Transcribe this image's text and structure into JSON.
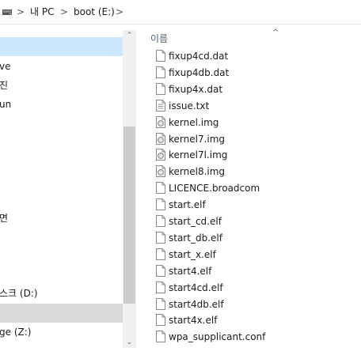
{
  "address": {
    "crumbs": [
      "내 PC",
      "boot (E:)"
    ],
    "separators": [
      ">",
      ">",
      ">"
    ]
  },
  "nav": {
    "items": [
      {
        "label": "",
        "state": "selected"
      },
      {
        "label": "ve",
        "state": ""
      },
      {
        "label": "진",
        "state": ""
      },
      {
        "label": "un",
        "state": ""
      },
      {
        "label": "",
        "state": ""
      },
      {
        "label": "",
        "state": ""
      },
      {
        "label": "",
        "state": ""
      },
      {
        "label": "",
        "state": ""
      },
      {
        "label": "면",
        "state": ""
      },
      {
        "label": "",
        "state": ""
      },
      {
        "label": "",
        "state": ""
      },
      {
        "label": "스크 (D:)",
        "state": ""
      },
      {
        "label": "",
        "state": "focused"
      },
      {
        "label": "ge (Z:)",
        "state": ""
      }
    ],
    "scroll_up_glyph": "⌃",
    "scroll_down_glyph": "⌄"
  },
  "filelist": {
    "column_header": "이름",
    "sort_glyph": "^",
    "files": [
      {
        "name": "fixup4cd.dat",
        "icon": "generic-file-icon"
      },
      {
        "name": "fixup4db.dat",
        "icon": "generic-file-icon"
      },
      {
        "name": "fixup4x.dat",
        "icon": "generic-file-icon"
      },
      {
        "name": "issue.txt",
        "icon": "text-file-icon"
      },
      {
        "name": "kernel.img",
        "icon": "disc-image-icon"
      },
      {
        "name": "kernel7.img",
        "icon": "disc-image-icon"
      },
      {
        "name": "kernel7l.img",
        "icon": "disc-image-icon"
      },
      {
        "name": "kernel8.img",
        "icon": "disc-image-icon"
      },
      {
        "name": "LICENCE.broadcom",
        "icon": "generic-file-icon"
      },
      {
        "name": "start.elf",
        "icon": "generic-file-icon"
      },
      {
        "name": "start_cd.elf",
        "icon": "generic-file-icon"
      },
      {
        "name": "start_db.elf",
        "icon": "generic-file-icon"
      },
      {
        "name": "start_x.elf",
        "icon": "generic-file-icon"
      },
      {
        "name": "start4.elf",
        "icon": "generic-file-icon"
      },
      {
        "name": "start4cd.elf",
        "icon": "generic-file-icon"
      },
      {
        "name": "start4db.elf",
        "icon": "generic-file-icon"
      },
      {
        "name": "start4x.elf",
        "icon": "generic-file-icon"
      },
      {
        "name": "wpa_supplicant.conf",
        "icon": "generic-file-icon"
      }
    ]
  },
  "colors": {
    "selected_bg": "#cce8ff",
    "focused_bg": "#d9d9d9",
    "header_text": "#4c607a"
  }
}
